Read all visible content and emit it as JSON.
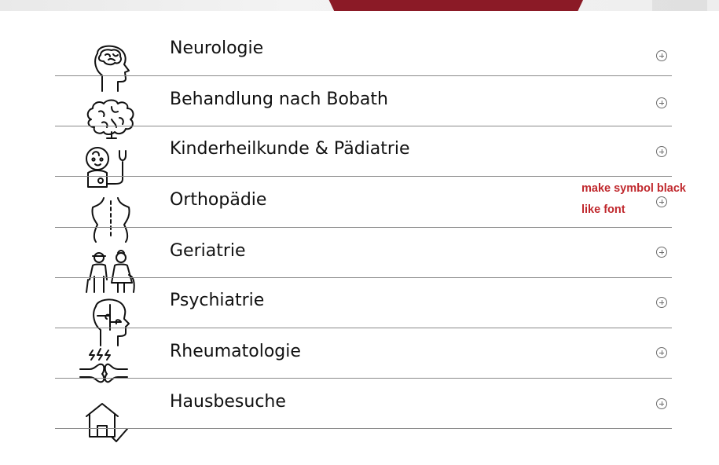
{
  "accordion": {
    "items": [
      {
        "label": "Neurologie",
        "icon": "brain-head-icon"
      },
      {
        "label": "Behandlung nach Bobath",
        "icon": "brain-icon"
      },
      {
        "label": "Kinderheilkunde & Pädiatrie",
        "icon": "baby-stethoscope-icon"
      },
      {
        "label": "Orthopädie",
        "icon": "spine-back-icon"
      },
      {
        "label": "Geriatrie",
        "icon": "elderly-couple-icon"
      },
      {
        "label": "Psychiatrie",
        "icon": "puzzle-head-icon"
      },
      {
        "label": "Rheumatologie",
        "icon": "joint-pain-icon"
      },
      {
        "label": "Hausbesuche",
        "icon": "house-check-icon"
      }
    ],
    "expand_icon": "plus-circle-icon"
  },
  "annotation": {
    "line1": "make symbol black",
    "line2": "like font",
    "color": "#c0282d"
  },
  "hero": {
    "accent_color": "#8b1a26"
  }
}
